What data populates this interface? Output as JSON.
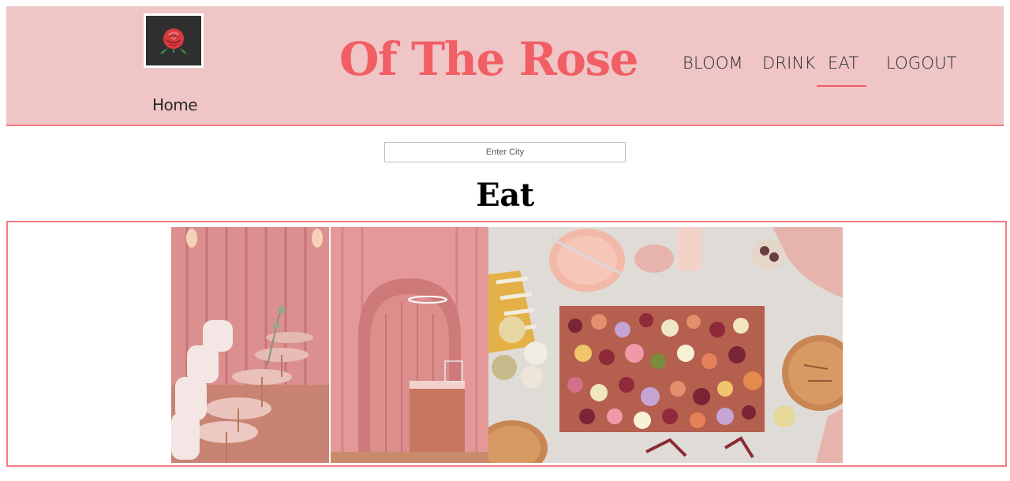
{
  "header": {
    "logo_icon": "rose-icon",
    "home_label": "Home",
    "title": "Of The Rose",
    "nav": {
      "bloom": "BLOOM",
      "drink": "DRINK",
      "eat": "EAT",
      "logout": "LOGOUT"
    },
    "active_nav": "EAT"
  },
  "search": {
    "placeholder": "Enter City",
    "value": ""
  },
  "main": {
    "heading": "Eat"
  },
  "colors": {
    "header_bg": "#efc5c6",
    "accent": "#f15e64",
    "border": "#f27c82"
  }
}
